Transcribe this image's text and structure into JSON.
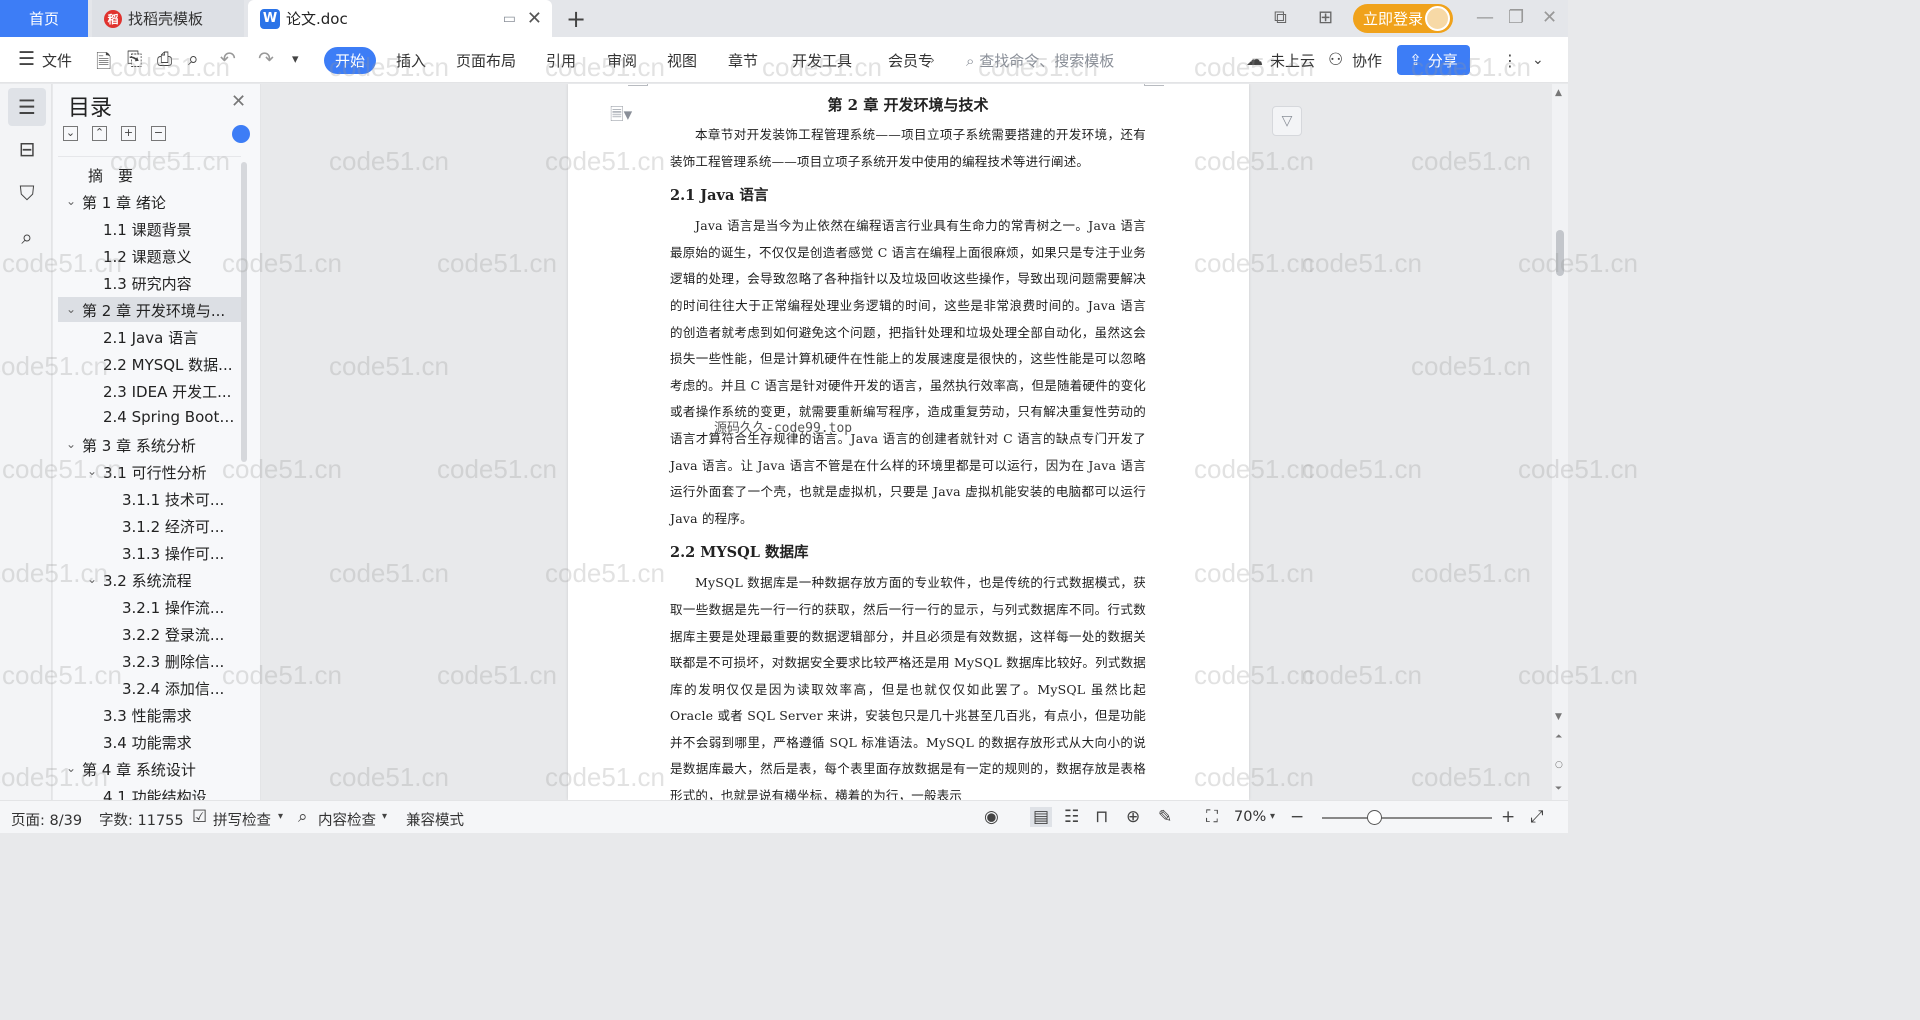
{
  "tabs": {
    "home": "首页",
    "template": "找稻壳模板",
    "doc": "论文.doc",
    "login": "立即登录"
  },
  "toolbar": {
    "file": "文件",
    "start": "开始",
    "menu": [
      "插入",
      "页面布局",
      "引用",
      "审阅",
      "视图",
      "章节",
      "开发工具",
      "会员专"
    ],
    "search_placeholder": "查找命令、搜索模板",
    "cloud": "未上云",
    "collab": "协作",
    "share": "分享"
  },
  "toc": {
    "title": "目录",
    "items": [
      {
        "label": "摘　要",
        "level": 1,
        "chevron": false
      },
      {
        "label": "第 1 章  绪论",
        "level": 1,
        "chevron": true
      },
      {
        "label": "1.1  课题背景",
        "level": 2
      },
      {
        "label": "1.2  课题意义",
        "level": 2
      },
      {
        "label": "1.3  研究内容",
        "level": 2
      },
      {
        "label": "第 2 章  开发环境与...",
        "level": 1,
        "chevron": true,
        "selected": true
      },
      {
        "label": "2.1 Java 语言",
        "level": 2
      },
      {
        "label": "2.2 MYSQL 数据...",
        "level": 2
      },
      {
        "label": "2.3 IDEA 开发工...",
        "level": 2
      },
      {
        "label": "2.4 Spring Boot ...",
        "level": 2
      },
      {
        "label": "第 3 章  系统分析",
        "level": 1,
        "chevron": true
      },
      {
        "label": "3.1  可行性分析",
        "level": 2,
        "chevron": true
      },
      {
        "label": "3.1.1  技术可...",
        "level": 3
      },
      {
        "label": "3.1.2  经济可...",
        "level": 3
      },
      {
        "label": "3.1.3  操作可...",
        "level": 3
      },
      {
        "label": "3.2  系统流程",
        "level": 2,
        "chevron": true
      },
      {
        "label": "3.2.1  操作流...",
        "level": 3
      },
      {
        "label": "3.2.2  登录流...",
        "level": 3
      },
      {
        "label": "3.2.3  删除信...",
        "level": 3
      },
      {
        "label": "3.2.4  添加信...",
        "level": 3
      },
      {
        "label": "3.3  性能需求",
        "level": 2
      },
      {
        "label": "3.4  功能需求",
        "level": 2
      },
      {
        "label": "第 4 章  系统设计",
        "level": 1,
        "chevron": true
      },
      {
        "label": "4.1  功能结构设...",
        "level": 2
      }
    ]
  },
  "document": {
    "chapter_title": "第 2 章  开发环境与技术",
    "intro": "本章节对开发装饰工程管理系统——项目立项子系统需要搭建的开发环境，还有装饰工程管理系统——项目立项子系统开发中使用的编程技术等进行阐述。",
    "h_java": "2.1 Java 语言",
    "java_para": "Java 语言是当今为止依然在编程语言行业具有生命力的常青树之一。Java 语言最原始的诞生，不仅仅是创造者感觉 C 语言在编程上面很麻烦，如果只是专注于业务逻辑的处理，会导致忽略了各种指针以及垃圾回收这些操作，导致出现问题需要解决的时间往往大于正常编程处理业务逻辑的时间，这些是非常浪费时间的。Java 语言的创造者就考虑到如何避免这个问题，把指针处理和垃圾处理全部自动化，虽然这会损失一些性能，但是计算机硬件在性能上的发展速度是很快的，这些性能是可以忽略考虑的。并且 C 语言是针对硬件开发的语言，虽然执行效率高，但是随着硬件的变化或者操作系统的变更，就需要重新编写程序，造成重复劳动，只有解决重复性劳动的语言才算符合生存规律的语言。Java 语言的创建者就针对 C 语言的缺点专门开发了 Java 语言。让 Java 语言不管是在什么样的环境里都是可以运行，因为在 Java 语言运行外面套了一个壳，也就是虚拟机，只要是 Java 虚拟机能安装的电脑都可以运行 Java 的程序。",
    "h_mysql": "2.2 MYSQL 数据库",
    "mysql_para": "MySQL 数据库是一种数据存放方面的专业软件，也是传统的行式数据模式，获取一些数据是先一行一行的获取，然后一行一行的显示，与列式数据库不同。行式数据库主要是处理最重要的数据逻辑部分，并且必须是有效数据，这样每一处的数据关联都是不可损坏，对数据安全要求比较严格还是用 MySQL 数据库比较好。列式数据库的发明仅仅是因为读取效率高，但是也就仅仅如此罢了。MySQL 虽然比起 Oracle 或者 SQL Server 来讲，安装包只是几十兆甚至几百兆，有点小，但是功能并不会弱到哪里，严格遵循 SQL 标准语法。MySQL 的数据存放形式从大向小的说是数据库最大，然后是表，每个表里面存放数据是有一定的规则的，数据存放是表格形式的，也就是说有横坐标，横着的为行，一般表示",
    "overlay_text": "源码久久-code99.top"
  },
  "status": {
    "page": "页面: 8/39",
    "words": "字数: 11755",
    "spell": "拼写检查",
    "content_check": "内容检查",
    "compat": "兼容模式",
    "zoom": "70%"
  },
  "watermark": "code51.cn"
}
